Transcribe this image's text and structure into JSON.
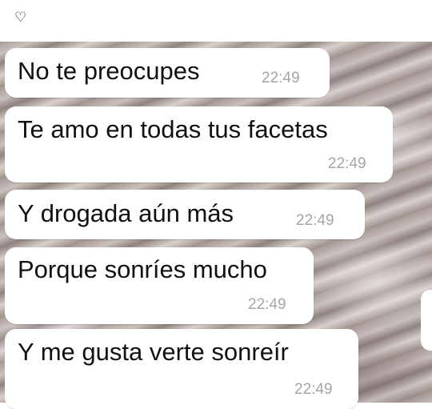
{
  "header": {
    "icon": "heart-outline-icon",
    "icon_glyph": "♡"
  },
  "messages": [
    {
      "text": "No te preocupes",
      "time": "22:49"
    },
    {
      "text": "Te amo en todas tus facetas",
      "time": "22:49"
    },
    {
      "text": "Y drogada aún más",
      "time": "22:49"
    },
    {
      "text": "Porque sonríes mucho",
      "time": "22:49"
    },
    {
      "text": "Y me gusta verte sonreír",
      "time": "22:49"
    }
  ],
  "colors": {
    "bubble": "#ffffff",
    "timestamp": "#a5a5a5",
    "text": "#111111"
  }
}
